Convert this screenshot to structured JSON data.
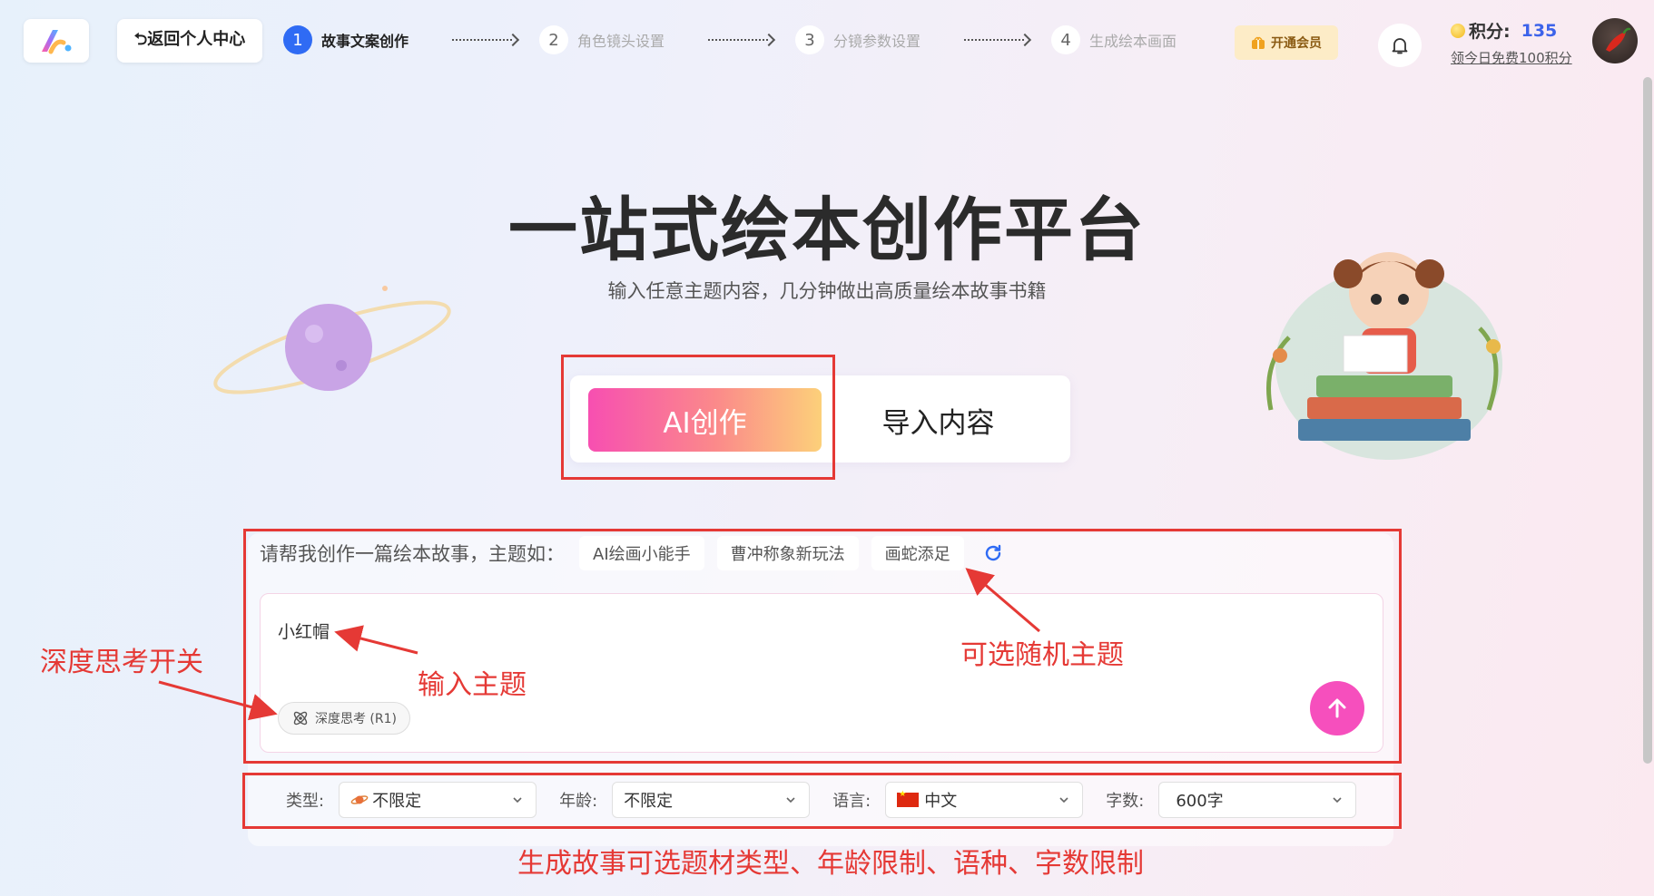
{
  "header": {
    "back_label": "⮌返回个人中心",
    "steps": [
      {
        "num": "1",
        "label": "故事文案创作"
      },
      {
        "num": "2",
        "label": "角色镜头设置"
      },
      {
        "num": "3",
        "label": "分镜参数设置"
      },
      {
        "num": "4",
        "label": "生成绘本画面"
      }
    ],
    "vip_label": "开通会员",
    "points_label": "积分:",
    "points_value": "135",
    "daily_link": "领今日免费100积分"
  },
  "hero": {
    "title": "一站式绘本创作平台",
    "subtitle": "输入任意主题内容，几分钟做出高质量绘本故事书籍",
    "tab_ai": "AI创作",
    "tab_import": "导入内容"
  },
  "prompt": {
    "suggest_label": "请帮我创作一篇绘本故事，主题如：",
    "suggestions": [
      "AI绘画小能手",
      "曹冲称象新玩法",
      "画蛇添足"
    ],
    "input_value": "小红帽",
    "deep_think_label": "深度思考 (R1)"
  },
  "filters": {
    "type_label": "类型:",
    "type_value": "不限定",
    "age_label": "年龄:",
    "age_value": "不限定",
    "lang_label": "语言:",
    "lang_value": "中文",
    "words_label": "字数:",
    "words_value": "600字"
  },
  "annotations": {
    "deep_think": "深度思考开关",
    "input_topic": "输入主题",
    "random_topic": "可选随机主题",
    "options": "生成故事可选题材类型、年龄限制、语种、字数限制"
  },
  "colors": {
    "accent": "#2f6bf4",
    "pink": "#f64fbd",
    "annotation": "#e53935"
  }
}
